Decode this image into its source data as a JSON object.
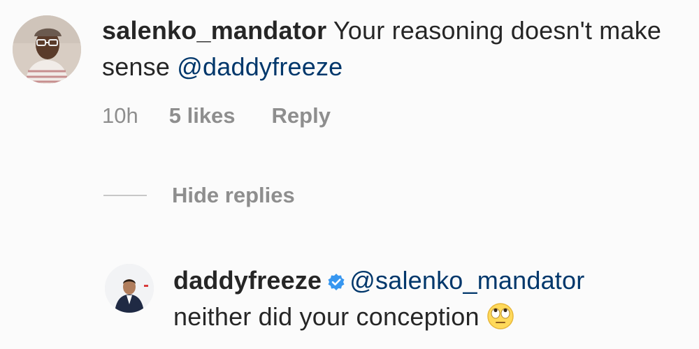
{
  "comment": {
    "username": "salenko_mandator",
    "text_before": " Your reasoning doesn't make sense ",
    "mention": "@daddyfreeze",
    "time": "10h",
    "likes": "5 likes",
    "reply_label": "Reply",
    "avatar_icon": "user-avatar-photo"
  },
  "hide_replies_label": "Hide replies",
  "reply": {
    "username": "daddyfreeze",
    "verified_icon": "verified-badge-icon",
    "mention": "@salenko_mandator",
    "text": "neither did your conception",
    "emoji_icon": "face-with-rolling-eyes-icon",
    "avatar_icon": "user-avatar-photo"
  },
  "colors": {
    "text": "#262626",
    "secondary": "#8e8e8e",
    "mention": "#00376b",
    "verified": "#3897f0"
  }
}
